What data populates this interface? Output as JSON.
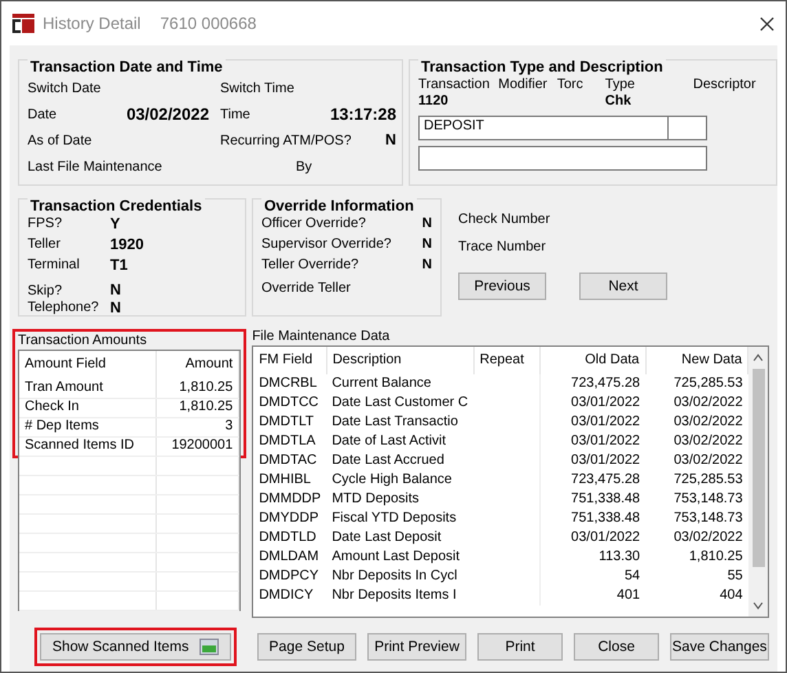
{
  "window": {
    "title": "History Detail",
    "account": "7610 000668"
  },
  "date_time": {
    "title": "Transaction Date and Time",
    "fields": [
      {
        "label": "Switch Date"
      },
      {
        "label": "Switch Time"
      },
      {
        "label": "Date",
        "value": "03/02/2022"
      },
      {
        "label": "Time",
        "value": "13:17:28"
      },
      {
        "label": "As of Date"
      },
      {
        "label": "Recurring ATM/POS?",
        "value": "N"
      },
      {
        "label": "Last File Maintenance"
      },
      {
        "label": "By"
      }
    ]
  },
  "type_description": {
    "title": "Transaction Type and Description",
    "columns": [
      {
        "label": "Transaction",
        "value": "1120"
      },
      {
        "label": "Modifier"
      },
      {
        "label": "Torc"
      },
      {
        "label": "Type",
        "value": "Chk"
      },
      {
        "label": "Descriptor"
      }
    ],
    "description": "DEPOSIT"
  },
  "credentials": {
    "title": "Transaction Credentials",
    "fields": [
      {
        "label": "FPS?",
        "value": "Y"
      },
      {
        "label": "Teller",
        "value": "1920"
      },
      {
        "label": "Terminal",
        "value": "T1"
      },
      {
        "label": "Skip?",
        "value": "N"
      },
      {
        "label": "Telephone?",
        "value": "N"
      }
    ]
  },
  "override": {
    "title": "Override Information",
    "fields": [
      {
        "label": "Officer Override?",
        "value": "N"
      },
      {
        "label": "Supervisor Override?",
        "value": "N"
      },
      {
        "label": "Teller Override?",
        "value": "N"
      },
      {
        "label": "Override Teller"
      }
    ]
  },
  "numbers": [
    "Check Number",
    "Trace Number"
  ],
  "nav_buttons": [
    "Previous",
    "Next"
  ],
  "amounts": {
    "title": "Transaction Amounts",
    "columns": [
      "Amount Field",
      "Amount"
    ],
    "rows": [
      [
        "Tran Amount",
        "1,810.25"
      ],
      [
        "Check In",
        "1,810.25"
      ],
      [
        "# Dep Items",
        "3"
      ],
      [
        "Scanned Items ID",
        "19200001"
      ]
    ]
  },
  "file_maintenance": {
    "title": "File Maintenance Data",
    "columns": [
      "FM Field",
      "Description",
      "Repeat",
      "Old Data",
      "New Data"
    ],
    "rows": [
      [
        "DMCRBL",
        "Current Balance",
        "",
        "723,475.28",
        "725,285.53"
      ],
      [
        "DMDTCC",
        "Date Last Customer C",
        "",
        "03/01/2022",
        "03/02/2022"
      ],
      [
        "DMDTLT",
        "Date Last Transactio",
        "",
        "03/01/2022",
        "03/02/2022"
      ],
      [
        "DMDTLA",
        "Date of Last Activit",
        "",
        "03/01/2022",
        "03/02/2022"
      ],
      [
        "DMDTAC",
        "Date Last Accrued",
        "",
        "03/01/2022",
        "03/02/2022"
      ],
      [
        "DMHIBL",
        "Cycle High Balance",
        "",
        "723,475.28",
        "725,285.53"
      ],
      [
        "DMMDDP",
        "MTD Deposits",
        "",
        "751,338.48",
        "753,148.73"
      ],
      [
        "DMYDDP",
        "Fiscal YTD Deposits",
        "",
        "751,338.48",
        "753,148.73"
      ],
      [
        "DMDTLD",
        "Date Last Deposit",
        "",
        "03/01/2022",
        "03/02/2022"
      ],
      [
        "DMLDAM",
        "Amount Last Deposit",
        "",
        "113.30",
        "1,810.25"
      ],
      [
        "DMDPCY",
        "Nbr Deposits In Cycl",
        "",
        "54",
        "55"
      ],
      [
        "DMDICY",
        "Nbr Deposits Items I",
        "",
        "401",
        "404"
      ]
    ]
  },
  "show_scanned_button": "Show Scanned Items",
  "footer_buttons": [
    "Page Setup",
    "Print Preview",
    "Print",
    "Close",
    "Save Changes"
  ]
}
